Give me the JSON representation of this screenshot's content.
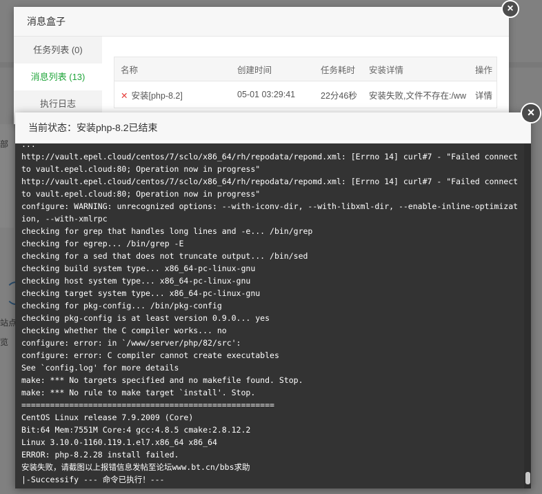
{
  "background": {
    "left_fragment_1": "部",
    "left_fragment_2": "站点",
    "left_fragment_3": "览"
  },
  "message_box": {
    "title": "消息盒子",
    "sidebar": [
      {
        "label": "任务列表 (0)"
      },
      {
        "label": "消息列表 (13)"
      },
      {
        "label": "执行日志"
      }
    ],
    "table": {
      "headers": [
        "名称",
        "创建时间",
        "任务耗时",
        "安装详情",
        "操作"
      ],
      "rows": [
        {
          "name": "安装[php-8.2]",
          "created": "05-01 03:29:41",
          "duration": "22分46秒",
          "detail": "安装失败,文件不存在:/ww",
          "action": "详情"
        }
      ]
    },
    "close_icon": "×"
  },
  "install_log": {
    "status_label": "当前状态：安装php-8.2已结束",
    "close_icon": "×",
    "lines": [
      "...",
      "http://vault.epel.cloud/centos/7/sclo/x86_64/rh/repodata/repomd.xml: [Errno 14] curl#7 - \"Failed connect to vault.epel.cloud:80; Operation now in progress\"",
      "http://vault.epel.cloud/centos/7/sclo/x86_64/rh/repodata/repomd.xml: [Errno 14] curl#7 - \"Failed connect to vault.epel.cloud:80; Operation now in progress\"",
      "configure: WARNING: unrecognized options: --with-iconv-dir, --with-libxml-dir, --enable-inline-optimization, --with-xmlrpc",
      "checking for grep that handles long lines and -e... /bin/grep",
      "checking for egrep... /bin/grep -E",
      "checking for a sed that does not truncate output... /bin/sed",
      "checking build system type... x86_64-pc-linux-gnu",
      "checking host system type... x86_64-pc-linux-gnu",
      "checking target system type... x86_64-pc-linux-gnu",
      "checking for pkg-config... /bin/pkg-config",
      "checking pkg-config is at least version 0.9.0... yes",
      "checking whether the C compiler works... no",
      "configure: error: in `/www/server/php/82/src':",
      "configure: error: C compiler cannot create executables",
      "See `config.log' for more details",
      "make: *** No targets specified and no makefile found. Stop.",
      "make: *** No rule to make target `install'. Stop.",
      "=====================================================",
      "CentOS Linux release 7.9.2009 (Core)",
      "Bit:64 Mem:7551M Core:4 gcc:4.8.5 cmake:2.8.12.2",
      "Linux 3.10.0-1160.119.1.el7.x86_64 x86_64",
      "ERROR: php-8.2.28 install failed.",
      "安装失败，请截图以上报错信息发帖至论坛www.bt.cn/bbs求助",
      "|-Successify --- 命令已执行！---"
    ]
  }
}
